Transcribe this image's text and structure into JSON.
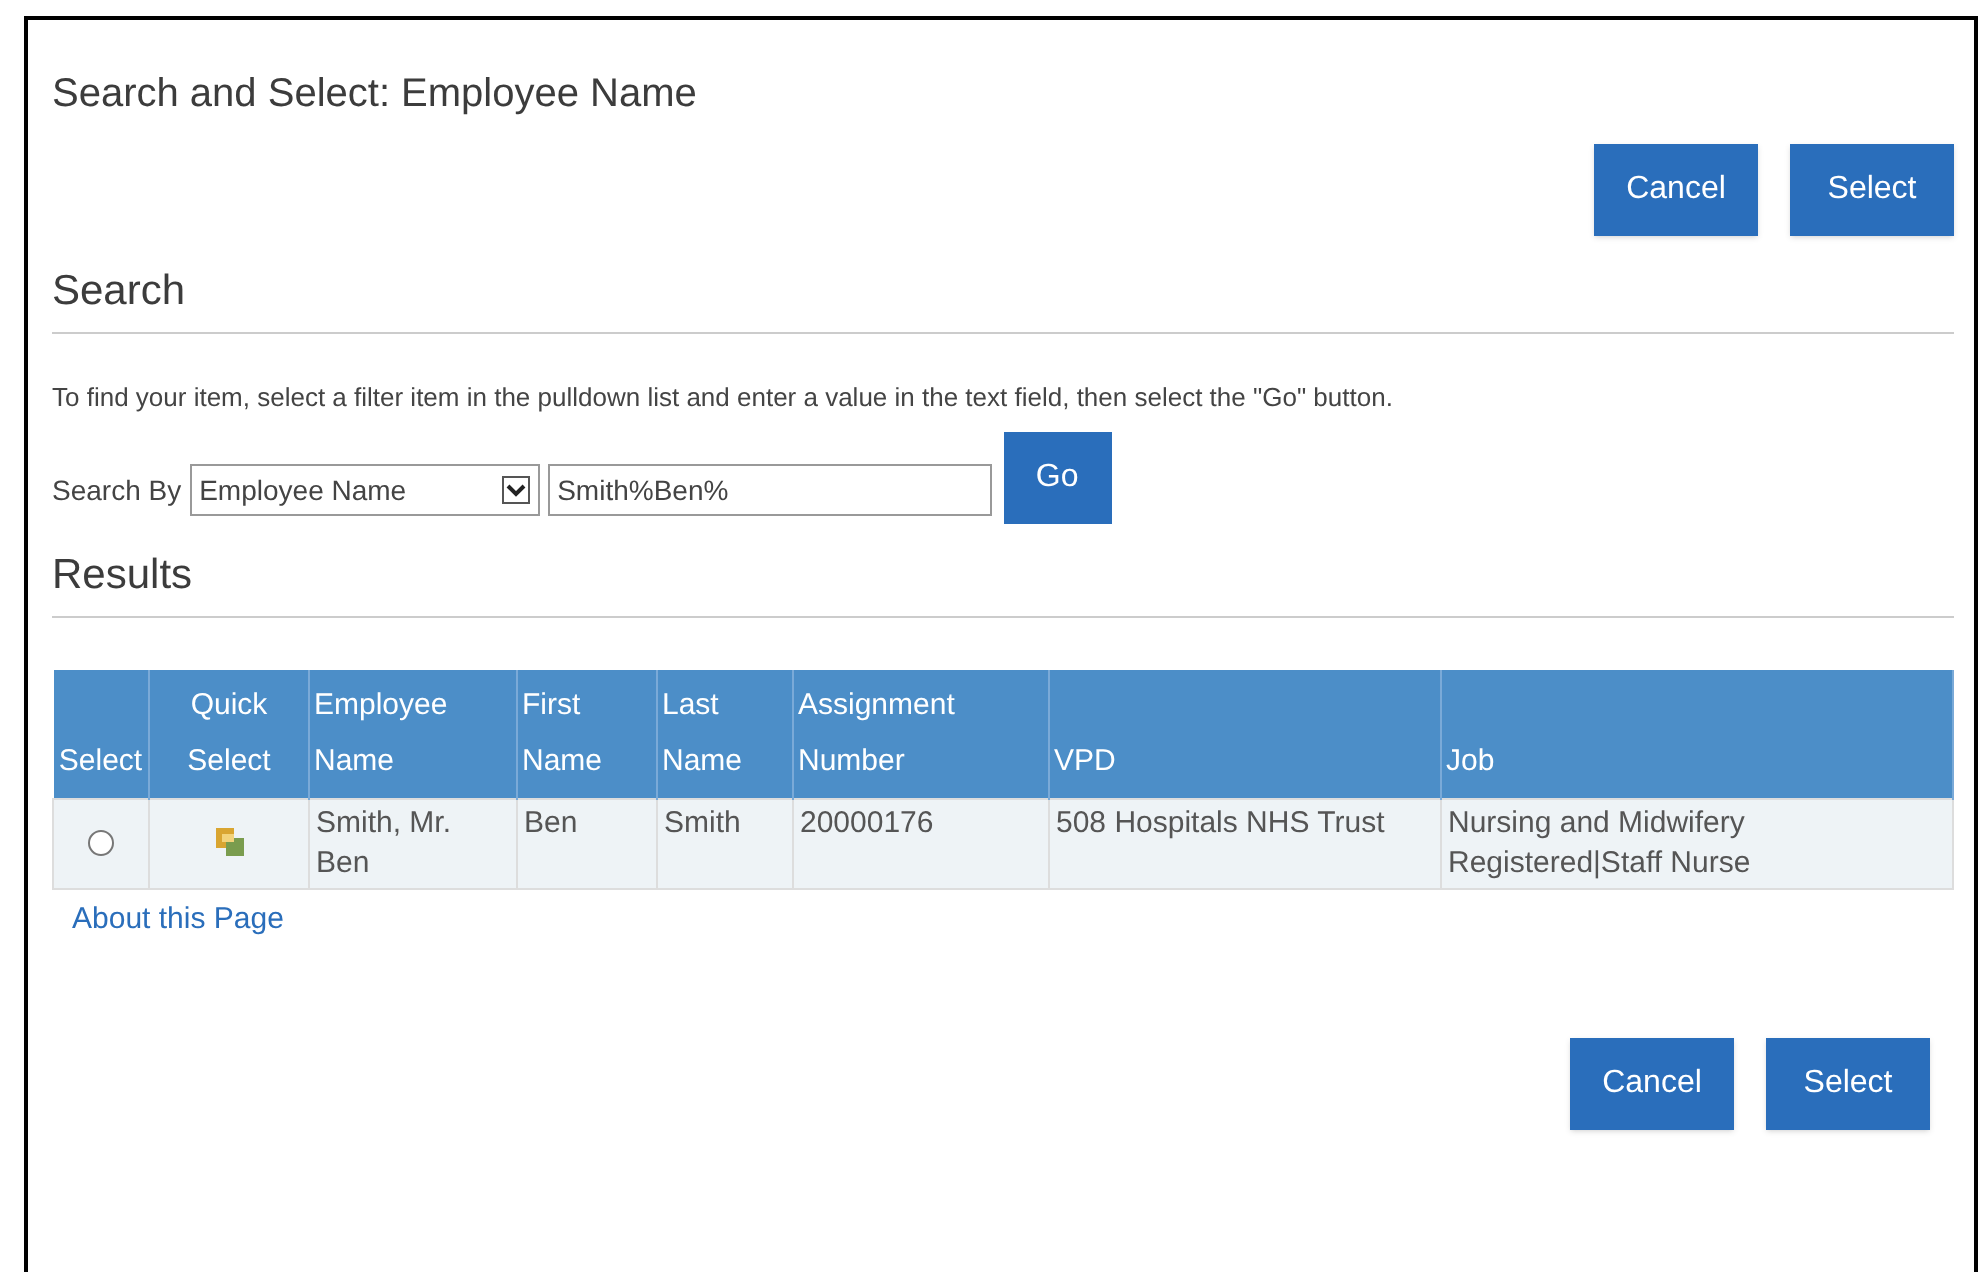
{
  "title": "Search and Select: Employee Name",
  "top_buttons": [
    "Cancel",
    "Select"
  ],
  "search": {
    "heading": "Search",
    "instructions": "To find your item, select a filter item in the pulldown list and enter a value in the text field, then select the \"Go\" button.",
    "label": "Search By",
    "filter": "Employee Name",
    "value": "Smith%Ben%",
    "go": "Go"
  },
  "results": {
    "heading": "Results",
    "columns": [
      "Select",
      "Quick Select",
      "Employee Name",
      "First Name",
      "Last Name",
      "Assignment Number",
      "VPD",
      "Job"
    ],
    "rows": [
      {
        "selected": false,
        "employee_name": "Smith, Mr. Ben",
        "first_name": "Ben",
        "last_name": "Smith",
        "assignment_number": "20000176",
        "vpd": "508 Hospitals NHS Trust",
        "job": "Nursing and Midwifery Registered|Staff Nurse"
      }
    ]
  },
  "about_link": "About this Page",
  "bottom_buttons": [
    "Cancel",
    "Select"
  ]
}
